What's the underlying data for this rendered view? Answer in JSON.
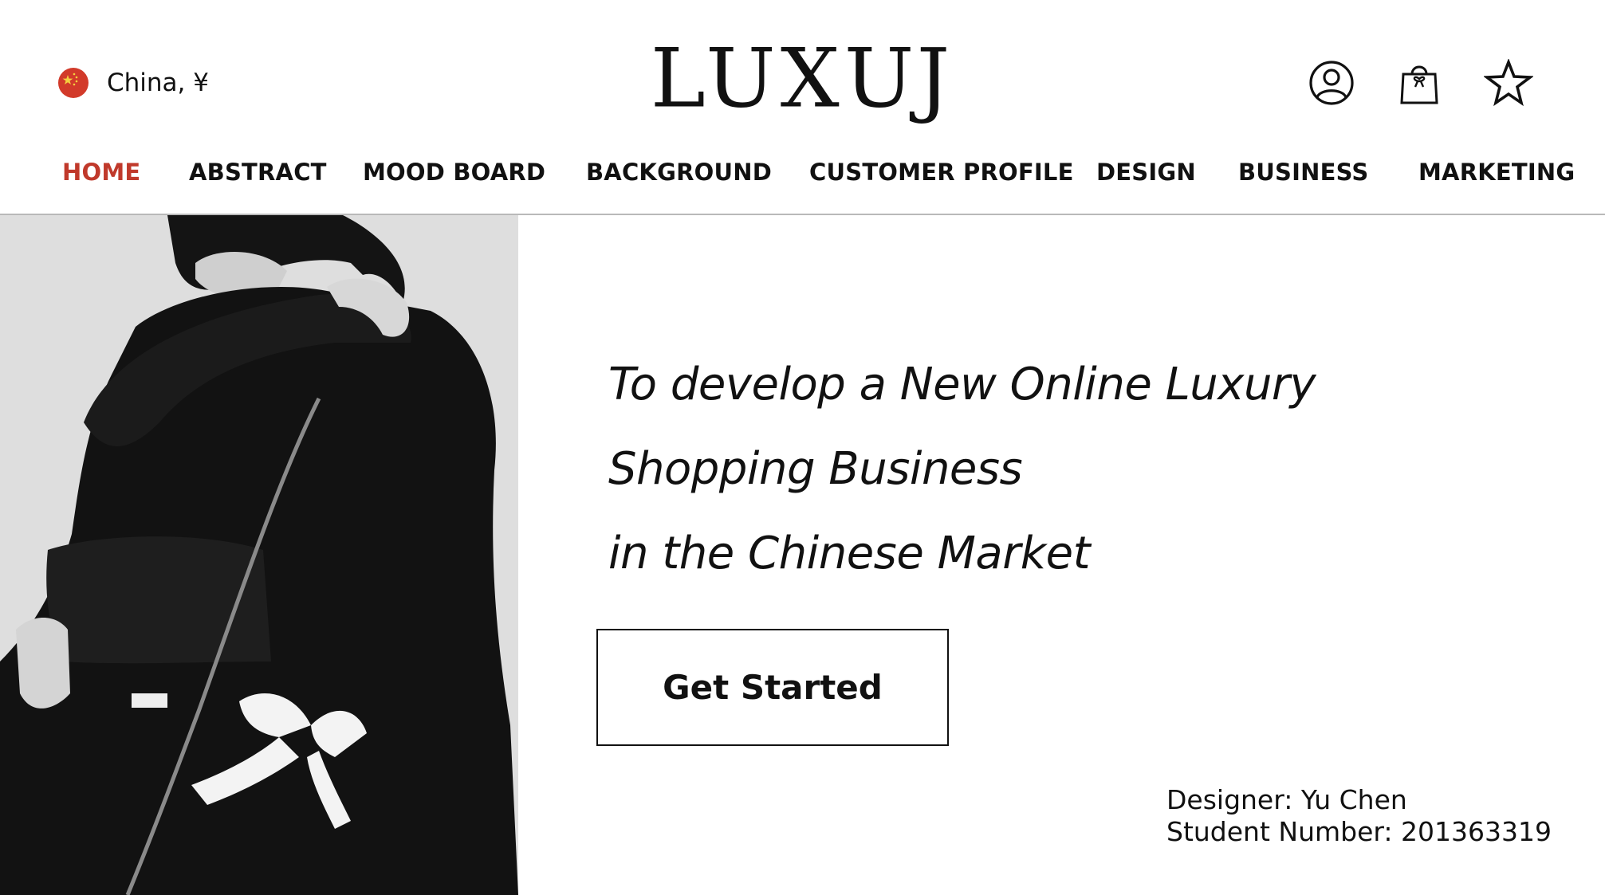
{
  "colors": {
    "accent": "#c0392b",
    "text": "#111111",
    "divider": "#b9b9b9",
    "flag_red": "#d23a2a",
    "flag_star": "#f4d03f"
  },
  "header": {
    "region_label": "China, ¥",
    "region_icon": "china-flag-icon",
    "logo_text": "LUXUJ",
    "icons": [
      "account-icon",
      "shopping-bag-icon",
      "star-icon"
    ]
  },
  "nav": {
    "items": [
      {
        "label": "HOME",
        "active": true
      },
      {
        "label": "ABSTRACT",
        "active": false
      },
      {
        "label": "MOOD BOARD",
        "active": false
      },
      {
        "label": "BACKGROUND",
        "active": false
      },
      {
        "label": "CUSTOMER PROFILE",
        "active": false
      },
      {
        "label": "DESIGN",
        "active": false
      },
      {
        "label": "BUSINESS",
        "active": false
      },
      {
        "label": "MARKETING",
        "active": false
      }
    ]
  },
  "hero": {
    "image": "fashion-model-photo",
    "headline": [
      "To develop a New Online Luxury",
      "Shopping Business",
      "in the Chinese Market"
    ],
    "cta_label": "Get Started"
  },
  "credits": {
    "designer": "Designer: Yu Chen",
    "student_number": "Student Number: 201363319"
  }
}
